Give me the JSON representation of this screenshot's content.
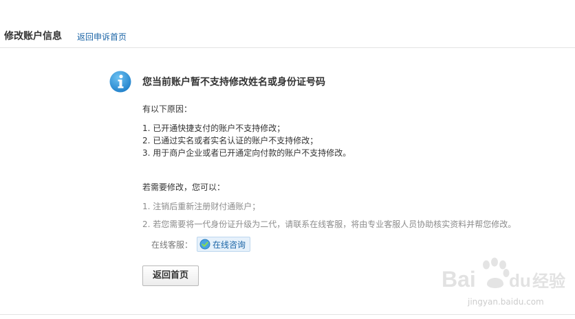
{
  "header": {
    "title": "修改账户信息",
    "back_link": "返回申诉首页"
  },
  "notice": {
    "icon": "info-icon",
    "title": "您当前账户暂不支持修改姓名或身份证号码",
    "reasons_heading": "有以下原因：",
    "reasons": [
      "1. 已开通快捷支付的账户不支持修改；",
      "2. 已通过实名或者实名认证的账户不支持修改；",
      "3. 用于商户企业或者已开通定向付款的账户不支持修改。"
    ],
    "options_heading": "若需要修改，您可以：",
    "options": [
      "1. 注销后重新注册财付通账户；",
      "2. 若您需要将一代身份证升级为二代，请联系在线客服，将由专业客服人员协助核实资料并帮您修改。"
    ],
    "service_label": "在线客服：",
    "chat_button": "在线咨询",
    "home_button": "返回首页"
  },
  "watermark": {
    "brand_a": "Bai",
    "brand_b": "du",
    "brand_c": "经验",
    "url": "jingyan.baidu.com"
  },
  "colors": {
    "link": "#1a64a6",
    "info_icon": "#2b8fd6",
    "muted_text": "#8c8c8c"
  }
}
